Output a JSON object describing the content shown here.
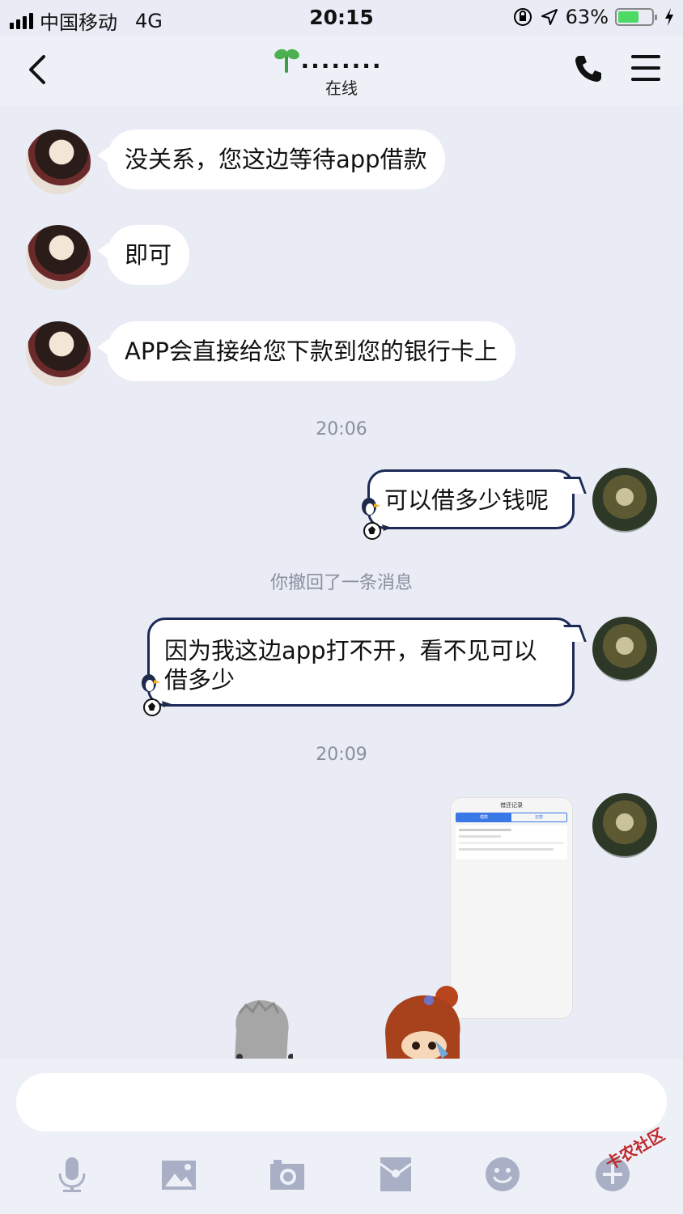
{
  "status_bar": {
    "carrier": "中国移动",
    "network": "4G",
    "time": "20:15",
    "battery": "63%",
    "battery_level": 0.63
  },
  "nav": {
    "title": "........",
    "subtitle": "在线"
  },
  "messages": {
    "in1": "没关系，您这边等待app借款",
    "in2": "即可",
    "in3": "APP会直接给您下款到您的银行卡上",
    "time1": "20:06",
    "out1": "可以借多少钱呢",
    "recall": "你撤回了一条消息",
    "out2": "因为我这边app打不开，看不见可以借多少",
    "time2": "20:09"
  },
  "image_message": {
    "title": "借还记录",
    "tab_borrow": "借款",
    "tab_repay": "还款"
  },
  "input": {
    "placeholder": ""
  },
  "toolbar": [
    "mic-icon",
    "image-icon",
    "camera-icon",
    "red-packet-icon",
    "emoji-icon",
    "plus-icon"
  ],
  "watermark": "卡农社区",
  "colors": {
    "background": "#e9ebf5",
    "bubble_out_border": "#1d2a57",
    "battery": "#4cd964"
  }
}
